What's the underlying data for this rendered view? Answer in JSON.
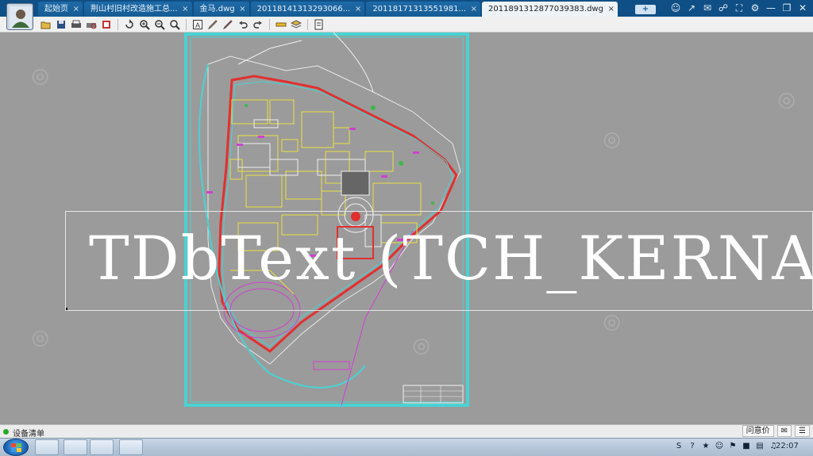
{
  "tabs": [
    {
      "label": "起始页",
      "active": false
    },
    {
      "label": "荆山村旧村改造施工总...",
      "active": false
    },
    {
      "label": "金马.dwg",
      "active": false
    },
    {
      "label": "20118141313293066...",
      "active": false
    },
    {
      "label": "20118171313551981...",
      "active": false
    },
    {
      "label": "2011891312877039383.dwg",
      "active": true
    }
  ],
  "tab_add_label": "+",
  "tab_close_glyph": "×",
  "title_icons": [
    "users-icon",
    "share-icon",
    "chat-icon",
    "link-icon",
    "fullscreen-icon",
    "settings-icon",
    "minimize-icon",
    "restore-icon",
    "close-icon"
  ],
  "toolbar_icons": [
    "open-icon",
    "save-icon",
    "print-icon",
    "print-preview-icon",
    "export-icon",
    "rotate-icon",
    "zoom-in-icon",
    "zoom-out-icon",
    "zoom-window-icon",
    "text-icon",
    "pencil-icon",
    "highlight-icon",
    "undo-icon",
    "redo-icon",
    "measure-icon",
    "layers-icon",
    "properties-icon"
  ],
  "overlay_text": "TDbText (TCH_KERNAL)",
  "status": {
    "text": "设备清单",
    "feedback_label": "问意价",
    "chat_label": "",
    "expand_label": ""
  },
  "taskbar": {
    "clock": "22:07"
  },
  "colors": {
    "titlebar": "#0f4f86",
    "canvas": "#9b9b9b",
    "cad_border": "#49d3d3",
    "cad_red": "#e03030",
    "cad_magenta": "#d040d0",
    "cad_yellow": "#e8e040",
    "cad_white": "#f0f0f0"
  }
}
